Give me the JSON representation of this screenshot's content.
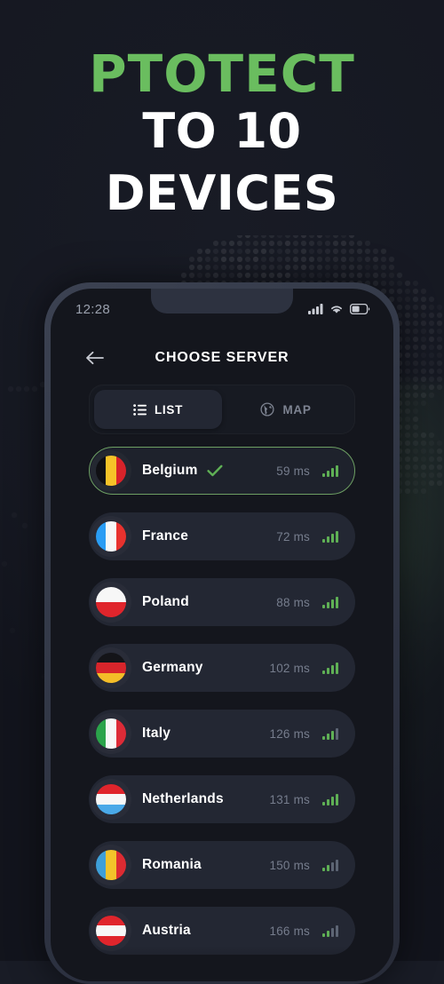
{
  "promo": {
    "line1": "PTOTECT",
    "line2": "TO 10",
    "line3": "DEVICES",
    "accent_color": "#6abd5f",
    "text_color": "#ffffff",
    "background_color": "#181b25"
  },
  "phone": {
    "status_bar": {
      "time": "12:28",
      "icons": [
        "cellular-signal-icon",
        "wifi-icon",
        "battery-icon"
      ],
      "battery_level_percent": 45
    },
    "header": {
      "back_icon": "arrow-left-icon",
      "title": "CHOOSE SERVER"
    },
    "tabs": [
      {
        "id": "list",
        "label": "LIST",
        "icon": "list-icon",
        "active": true
      },
      {
        "id": "map",
        "label": "MAP",
        "icon": "globe-icon",
        "active": false
      }
    ],
    "servers": [
      {
        "country": "Belgium",
        "ping": "59 ms",
        "selected": true,
        "check_icon": "checkmark-icon",
        "signal_bars": 4,
        "flag": {
          "orientation": "vertical",
          "colors": [
            "#101014",
            "#f6c328",
            "#d8232a"
          ]
        }
      },
      {
        "country": "France",
        "ping": "72 ms",
        "selected": false,
        "signal_bars": 4,
        "flag": {
          "orientation": "vertical",
          "colors": [
            "#2a9df4",
            "#f7f7f7",
            "#e8322e"
          ]
        }
      },
      {
        "country": "Poland",
        "ping": "88 ms",
        "selected": false,
        "signal_bars": 4,
        "flag": {
          "orientation": "horizontal",
          "colors": [
            "#f7f7f7",
            "#e0252c"
          ]
        }
      },
      {
        "country": "Germany",
        "ping": "102 ms",
        "selected": false,
        "signal_bars": 4,
        "flag": {
          "orientation": "horizontal",
          "colors": [
            "#141418",
            "#d8252b",
            "#f4bd28"
          ]
        }
      },
      {
        "country": "Italy",
        "ping": "126 ms",
        "selected": false,
        "signal_bars": 3,
        "flag": {
          "orientation": "vertical",
          "colors": [
            "#2ba44b",
            "#f7f7f7",
            "#dd2b37"
          ]
        }
      },
      {
        "country": "Netherlands",
        "ping": "131 ms",
        "selected": false,
        "signal_bars": 4,
        "flag": {
          "orientation": "horizontal",
          "colors": [
            "#e0252c",
            "#f7f7f7",
            "#4aa9e8"
          ]
        }
      },
      {
        "country": "Romania",
        "ping": "150 ms",
        "selected": false,
        "signal_bars": 2,
        "flag": {
          "orientation": "vertical",
          "colors": [
            "#3e9fd8",
            "#f3c32a",
            "#dc2b32"
          ]
        }
      },
      {
        "country": "Austria",
        "ping": "166 ms",
        "selected": false,
        "signal_bars": 2,
        "flag": {
          "orientation": "horizontal",
          "colors": [
            "#e0252c",
            "#f7f7f7",
            "#e0252c"
          ]
        }
      }
    ]
  }
}
